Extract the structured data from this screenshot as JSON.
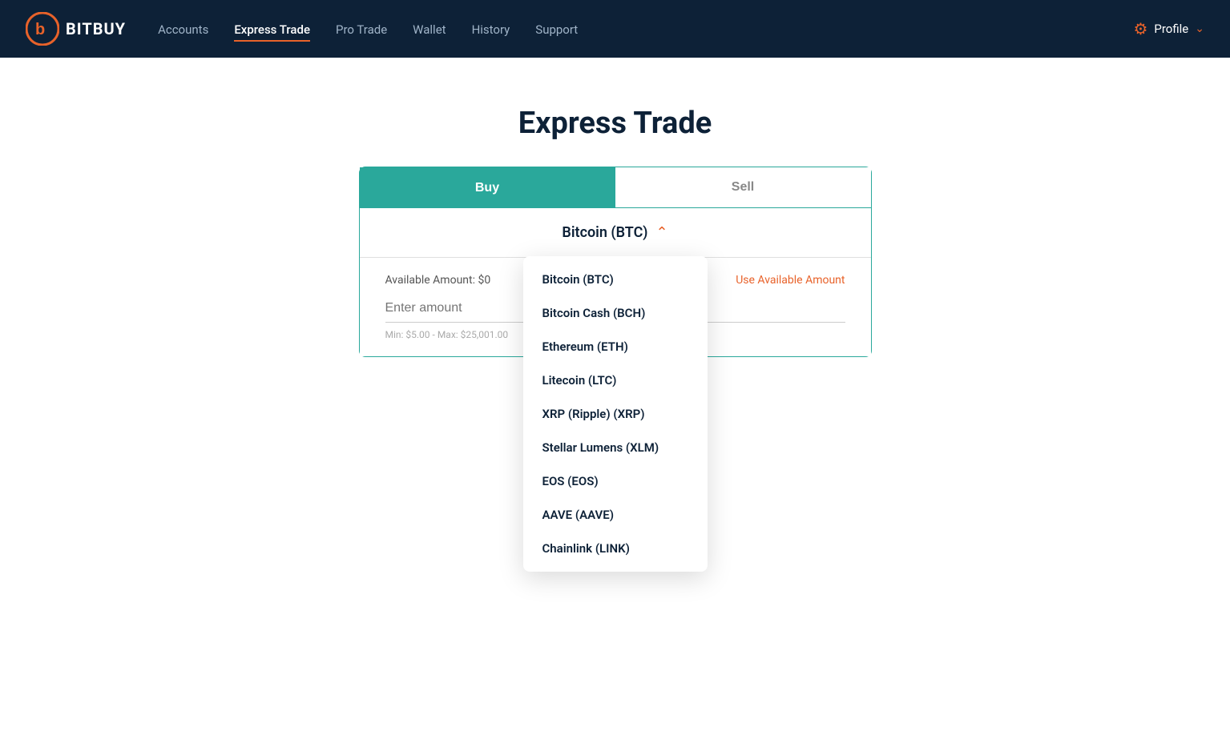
{
  "brand": {
    "name": "BITBUY"
  },
  "navbar": {
    "links": [
      {
        "id": "accounts",
        "label": "Accounts",
        "active": false
      },
      {
        "id": "express-trade",
        "label": "Express Trade",
        "active": true
      },
      {
        "id": "pro-trade",
        "label": "Pro Trade",
        "active": false
      },
      {
        "id": "wallet",
        "label": "Wallet",
        "active": false
      },
      {
        "id": "history",
        "label": "History",
        "active": false
      },
      {
        "id": "support",
        "label": "Support",
        "active": false
      }
    ],
    "profile": {
      "label": "Profile"
    }
  },
  "main": {
    "title": "Express Trade",
    "tabs": [
      {
        "id": "buy",
        "label": "Buy",
        "active": true
      },
      {
        "id": "sell",
        "label": "Sell",
        "active": false
      }
    ],
    "selected_currency": "Bitcoin (BTC)",
    "available_amount_label": "Available Amount:",
    "available_amount_value": "$0",
    "use_available_label": "Use Available Amount",
    "amount_placeholder": "Enter amount",
    "amount_hint": "Min: $5.00 - Max: $25,001.00",
    "dropdown_items": [
      "Bitcoin (BTC)",
      "Bitcoin Cash (BCH)",
      "Ethereum (ETH)",
      "Litecoin (LTC)",
      "XRP (Ripple) (XRP)",
      "Stellar Lumens (XLM)",
      "EOS (EOS)",
      "AAVE (AAVE)",
      "Chainlink (LINK)"
    ]
  }
}
